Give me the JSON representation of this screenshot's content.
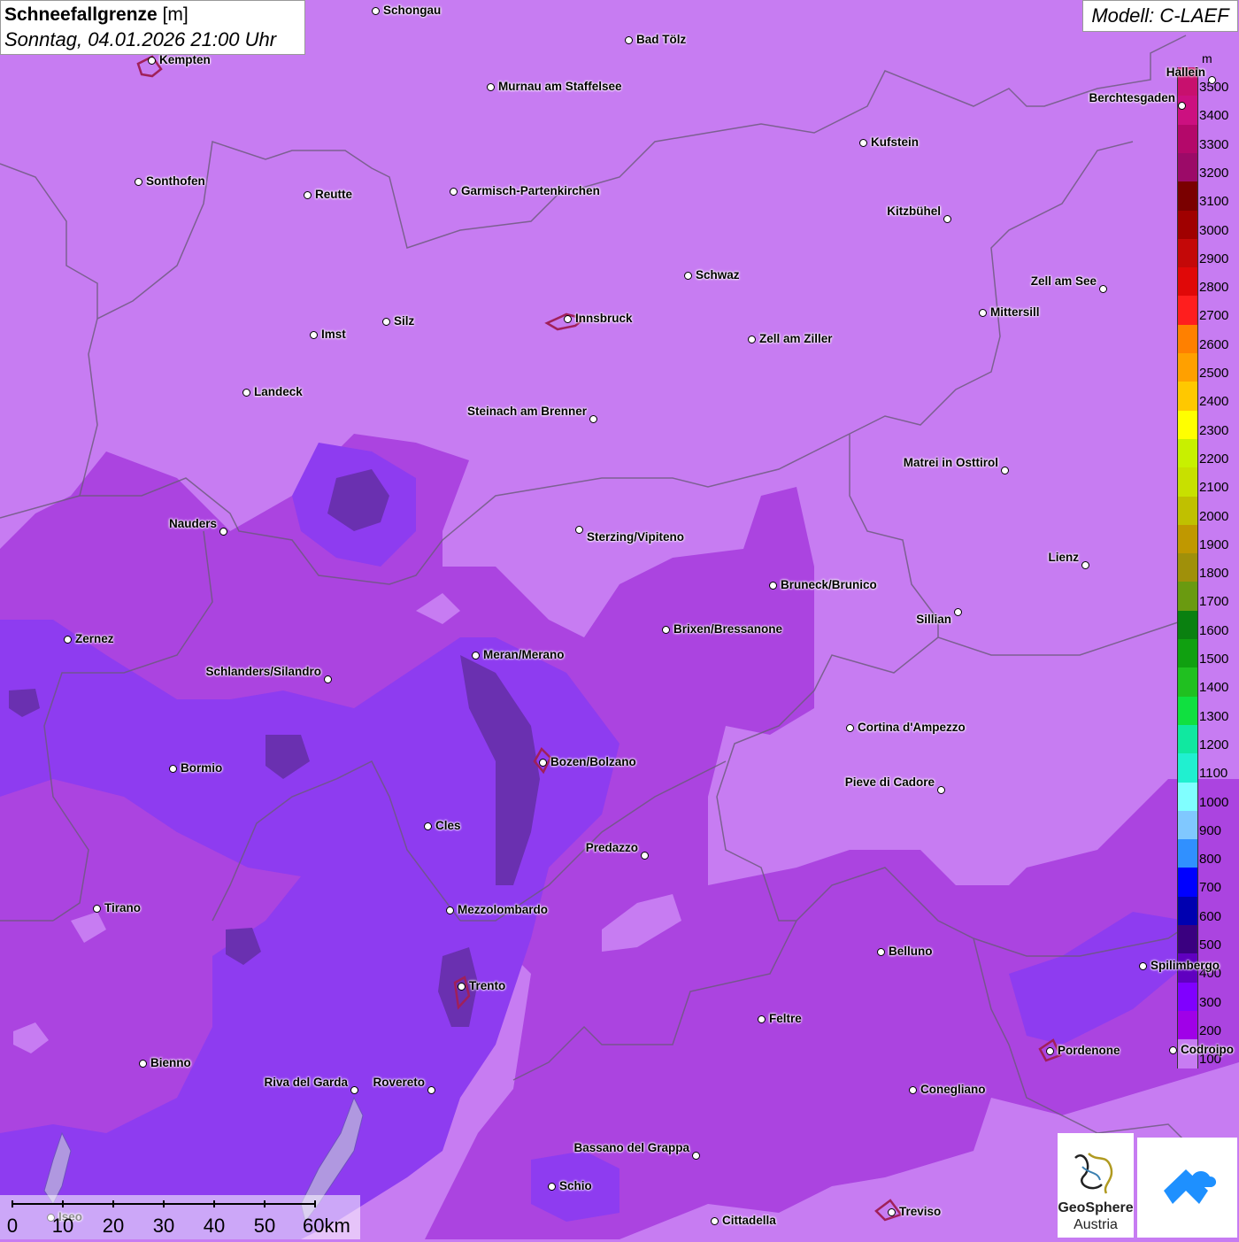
{
  "header": {
    "title": "Schneefallgrenze",
    "unit": "[m]",
    "datetime": "Sonntag, 04.01.2026 21:00 Uhr",
    "model": "Modell: C-LAEF"
  },
  "legend": {
    "unit": "m",
    "levels": [
      "3500",
      "3400",
      "3300",
      "3200",
      "3100",
      "3000",
      "2900",
      "2800",
      "2700",
      "2600",
      "2500",
      "2400",
      "2300",
      "2200",
      "2100",
      "2000",
      "1900",
      "1800",
      "1700",
      "1600",
      "1500",
      "1400",
      "1300",
      "1200",
      "1100",
      "1000",
      "900",
      "800",
      "700",
      "600",
      "500",
      "400",
      "300",
      "200",
      "100"
    ],
    "colors": [
      "#c8106e",
      "#cc1080",
      "#b4086a",
      "#9c0a68",
      "#7a0000",
      "#a00000",
      "#c40808",
      "#e00808",
      "#ff1e1e",
      "#ff8000",
      "#ffa000",
      "#ffc800",
      "#ffff00",
      "#c8f000",
      "#c8e000",
      "#c0c000",
      "#c09800",
      "#a0900a",
      "#6a9a10",
      "#0a8010",
      "#10a010",
      "#20c020",
      "#10e040",
      "#10e8a0",
      "#20f0d0",
      "#80ffff",
      "#80c8ff",
      "#3090ff",
      "#0000ff",
      "#0000b0",
      "#3a0080",
      "#6000c0",
      "#8000ff",
      "#a000e8",
      "#c77cf2"
    ]
  },
  "cities": [
    {
      "name": "Schongau"
    },
    {
      "name": "Bad Tölz"
    },
    {
      "name": "Kempten"
    },
    {
      "name": "Murnau am Staffelsee"
    },
    {
      "name": "Berchtesgaden"
    },
    {
      "name": "Kufstein"
    },
    {
      "name": "Sonthofen"
    },
    {
      "name": "Reutte"
    },
    {
      "name": "Garmisch-Partenkirchen"
    },
    {
      "name": "Kitzbühel"
    },
    {
      "name": "Schwaz"
    },
    {
      "name": "Zell am See"
    },
    {
      "name": "Mittersill"
    },
    {
      "name": "Innsbruck"
    },
    {
      "name": "Silz"
    },
    {
      "name": "Imst"
    },
    {
      "name": "Zell am Ziller"
    },
    {
      "name": "Landeck"
    },
    {
      "name": "Steinach am Brenner"
    },
    {
      "name": "Matrei in Osttirol"
    },
    {
      "name": "Nauders"
    },
    {
      "name": "Sterzing/Vipiteno"
    },
    {
      "name": "Lienz"
    },
    {
      "name": "Bruneck/Brunico"
    },
    {
      "name": "Sillian"
    },
    {
      "name": "Brixen/Bressanone"
    },
    {
      "name": "Zernez"
    },
    {
      "name": "Meran/Merano"
    },
    {
      "name": "Schlanders/Silandro"
    },
    {
      "name": "Cortina d'Ampezzo"
    },
    {
      "name": "Bozen/Bolzano"
    },
    {
      "name": "Bormio"
    },
    {
      "name": "Pieve di Cadore"
    },
    {
      "name": "Cles"
    },
    {
      "name": "Predazzo"
    },
    {
      "name": "Tirano"
    },
    {
      "name": "Mezzolombardo"
    },
    {
      "name": "Belluno"
    },
    {
      "name": "Spilimbergo"
    },
    {
      "name": "Trento"
    },
    {
      "name": "Feltre"
    },
    {
      "name": "Pordenone"
    },
    {
      "name": "Codroipo"
    },
    {
      "name": "Bienno"
    },
    {
      "name": "Riva del Garda"
    },
    {
      "name": "Rovereto"
    },
    {
      "name": "Conegliano"
    },
    {
      "name": "Bassano del Grappa"
    },
    {
      "name": "Schio"
    },
    {
      "name": "Treviso"
    },
    {
      "name": "Cittadella"
    },
    {
      "name": "Iseo"
    },
    {
      "name": "Hallein"
    }
  ],
  "scale": {
    "ticks": [
      "0",
      "10",
      "20",
      "30",
      "40",
      "50",
      "60km"
    ]
  },
  "logo": {
    "line1": "GeoSphere",
    "line2": "Austria"
  }
}
